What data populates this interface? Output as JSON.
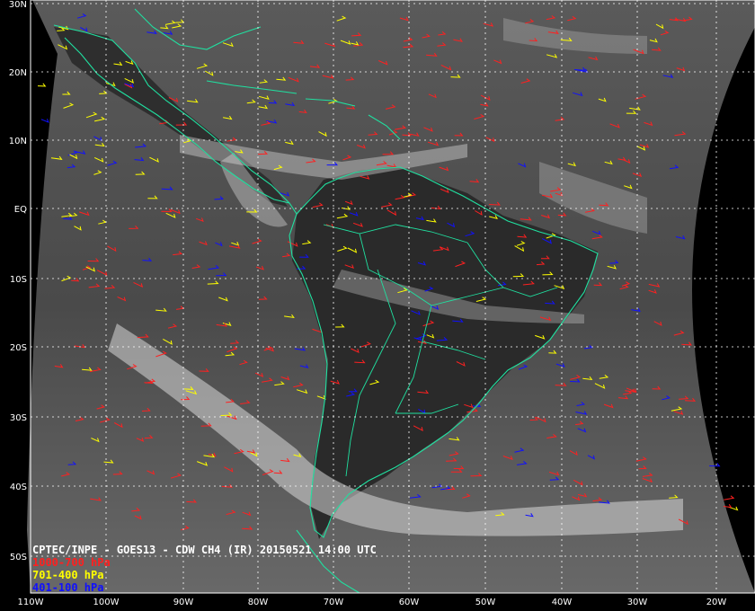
{
  "title": "CPTEC/INPE - GOES13 - CDW CH4 (IR) 20150521 14:00 UTC",
  "legend": {
    "items": [
      {
        "label": "1000-700 hPa",
        "color": "#ff2020"
      },
      {
        "label": "701-400 hPa",
        "color": "#ffff00"
      },
      {
        "label": "401-100 hPa",
        "color": "#1010ff"
      }
    ]
  },
  "colors": {
    "coastline": "#20e0a0",
    "grid": "#ffffff",
    "background": "#000000"
  },
  "grid": {
    "latitudes": [
      {
        "label": "30N"
      },
      {
        "label": "20N"
      },
      {
        "label": "10N"
      },
      {
        "label": "EQ"
      },
      {
        "label": "10S"
      },
      {
        "label": "20S"
      },
      {
        "label": "30S"
      },
      {
        "label": "40S"
      },
      {
        "label": "50S"
      }
    ],
    "longitudes": [
      {
        "label": "110W"
      },
      {
        "label": "100W"
      },
      {
        "label": "90W"
      },
      {
        "label": "80W"
      },
      {
        "label": "70W"
      },
      {
        "label": "60W"
      },
      {
        "label": "50W"
      },
      {
        "label": "40W"
      },
      {
        "label": "30W"
      },
      {
        "label": "20W"
      }
    ]
  }
}
